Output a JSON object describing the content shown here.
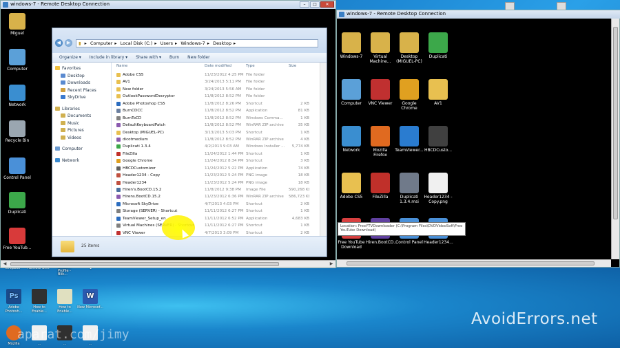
{
  "rdp_window_1": {
    "title": "windows-7 - Remote Desktop Connection"
  },
  "rdp_window_2": {
    "title": "windows-7 - Remote Desktop Connection"
  },
  "rdp1_desktop_icons": [
    {
      "label": "Miguel",
      "color": "#d8b24a"
    },
    {
      "label": "Computer",
      "color": "#5ba0d8"
    },
    {
      "label": "Network",
      "color": "#3a8ed0"
    },
    {
      "label": "Recycle Bin",
      "color": "#9aa6b0"
    },
    {
      "label": "Control Panel",
      "color": "#4a90d8"
    },
    {
      "label": "Duplicati",
      "color": "#3ca84a"
    },
    {
      "label": "Free YouTub...",
      "color": "#d83a3a"
    }
  ],
  "explorer": {
    "address": [
      "Computer",
      "Local Disk (C:)",
      "Users",
      "Windows-7",
      "Desktop"
    ],
    "toolbar": [
      "Organize ▾",
      "Include in library ▾",
      "Share with ▾",
      "Burn",
      "New folder"
    ],
    "nav": {
      "favorites_header": "Favorites",
      "favorites": [
        "Desktop",
        "Downloads",
        "Recent Places",
        "SkyDrive"
      ],
      "libraries_header": "Libraries",
      "libraries": [
        "Documents",
        "Music",
        "Pictures",
        "Videos"
      ],
      "computer": "Computer",
      "network": "Network"
    },
    "columns": {
      "name": "Name",
      "date": "Date modified",
      "type": "Type",
      "size": "Size"
    },
    "files": [
      {
        "name": "Adobe CS5",
        "date": "11/23/2012 4:25 PM",
        "type": "File folder",
        "size": "",
        "icon": "#e8c050"
      },
      {
        "name": "AV1",
        "date": "3/24/2013 5:11 PM",
        "type": "File folder",
        "size": "",
        "icon": "#e8c050"
      },
      {
        "name": "New folder",
        "date": "3/24/2013 5:56 AM",
        "type": "File folder",
        "size": "",
        "icon": "#e8c050"
      },
      {
        "name": "OutlookPasswordDecryptor",
        "date": "11/8/2012 8:52 PM",
        "type": "File folder",
        "size": "",
        "icon": "#e8c050"
      },
      {
        "name": "Adobe Photoshop CS5",
        "date": "11/8/2012 8:26 PM",
        "type": "Shortcut",
        "size": "2 KB",
        "icon": "#2a6cc0"
      },
      {
        "name": "BurnCDCC",
        "date": "11/8/2012 8:52 PM",
        "type": "Application",
        "size": "81 KB",
        "icon": "#6a7fa0"
      },
      {
        "name": "BurnToCD",
        "date": "11/8/2012 8:52 PM",
        "type": "Windows Comma...",
        "size": "1 KB",
        "icon": "#808080"
      },
      {
        "name": "DefaultKeyboardPatch",
        "date": "11/8/2012 8:52 PM",
        "type": "WinRAR ZIP archive",
        "size": "35 KB",
        "icon": "#8a5ab0"
      },
      {
        "name": "Desktop (MIGUEL-PC)",
        "date": "3/13/2013 5:03 PM",
        "type": "Shortcut",
        "size": "1 KB",
        "icon": "#e8c050"
      },
      {
        "name": "dicotmedium",
        "date": "11/8/2012 8:52 PM",
        "type": "WinRAR ZIP archive",
        "size": "4 KB",
        "icon": "#8a5ab0"
      },
      {
        "name": "Duplicati 1.3.4",
        "date": "4/2/2013 9:03 AM",
        "type": "Windows Installer ...",
        "size": "5,774 KB",
        "icon": "#3ca84a"
      },
      {
        "name": "FileZilla",
        "date": "11/24/2012 1:44 PM",
        "type": "Shortcut",
        "size": "1 KB",
        "icon": "#c0302a"
      },
      {
        "name": "Google Chrome",
        "date": "11/24/2012 8:34 PM",
        "type": "Shortcut",
        "size": "3 KB",
        "icon": "#e0a020"
      },
      {
        "name": "HBCDCustomizer",
        "date": "11/24/2012 5:22 PM",
        "type": "Application",
        "size": "74 KB",
        "icon": "#606060"
      },
      {
        "name": "Header1234 - Copy",
        "date": "11/23/2012 5:24 PM",
        "type": "PNG image",
        "size": "18 KB",
        "icon": "#c05040"
      },
      {
        "name": "Header1234",
        "date": "11/23/2012 5:24 PM",
        "type": "PNG image",
        "size": "18 KB",
        "icon": "#c05040"
      },
      {
        "name": "Hiren's.BootCD.15.2",
        "date": "11/8/2012 9:38 PM",
        "type": "Image File",
        "size": "590,268 KB",
        "icon": "#4a70a0"
      },
      {
        "name": "Hirens.BootCD.15.2",
        "date": "11/23/2012 6:36 PM",
        "type": "WinRAR ZIP archive",
        "size": "586,723 KB",
        "icon": "#8a5ab0"
      },
      {
        "name": "Microsoft SkyDrive",
        "date": "4/7/2013 4:03 PM",
        "type": "Shortcut",
        "size": "2 KB",
        "icon": "#2a6cc0"
      },
      {
        "name": "Storage (SERVER) - Shortcut",
        "date": "11/11/2012 6:27 PM",
        "type": "Shortcut",
        "size": "1 KB",
        "icon": "#808080"
      },
      {
        "name": "TeamViewer_Setup_en",
        "date": "11/11/2012 6:52 PM",
        "type": "Application",
        "size": "4,683 KB",
        "icon": "#2a6cc0"
      },
      {
        "name": "Virtual Machines (SERVER) - Shortcut",
        "date": "11/11/2012 6:27 PM",
        "type": "Shortcut",
        "size": "1 KB",
        "icon": "#808080"
      },
      {
        "name": "VNC Viewer",
        "date": "4/7/2013 3:09 PM",
        "type": "Shortcut",
        "size": "2 KB",
        "icon": "#c03030"
      }
    ],
    "status_count": "25 items"
  },
  "rdp2_desktop_icons": [
    {
      "label": "Windows-7",
      "color": "#d8b24a"
    },
    {
      "label": "Virtual Machine...",
      "color": "#d8b24a"
    },
    {
      "label": "Desktop (MIGUEL-PC)",
      "color": "#d8b24a"
    },
    {
      "label": "Duplicati",
      "color": "#3ca84a"
    },
    {
      "label": "Computer",
      "color": "#5ba0d8"
    },
    {
      "label": "VNC Viewer",
      "color": "#c03030"
    },
    {
      "label": "Google Chrome",
      "color": "#e0a020"
    },
    {
      "label": "AV1",
      "color": "#e8c050"
    },
    {
      "label": "Network",
      "color": "#3a8ed0"
    },
    {
      "label": "Mozilla Firefox",
      "color": "#e06a20"
    },
    {
      "label": "TeamViewer...",
      "color": "#2a7cd0"
    },
    {
      "label": "HBCDCusto...",
      "color": "#404040"
    },
    {
      "label": "Adobe CS5",
      "color": "#e8c050"
    },
    {
      "label": "FileZilla",
      "color": "#c0302a"
    },
    {
      "label": "Duplicati 1.3.4.msi",
      "color": "#707a8a"
    },
    {
      "label": "Header1234 - Copy.png",
      "color": "#f0f0f0"
    },
    {
      "label": "Free YouTube Download",
      "color": "#d84040"
    },
    {
      "label": "Hiren.BootCD...",
      "color": "#6040a0"
    },
    {
      "label": "Control Panel",
      "color": "#4a90d8"
    },
    {
      "label": "Header1234...",
      "color": "#4a90d8"
    }
  ],
  "tooltip": "Location: FreeYTVDownloader (C:\\Program Files\\DVDVideoSoft\\Free YouTube Download)",
  "local_desktop": {
    "top_labels": [
      "Dropbox",
      "Remote win7",
      "Outlook Profile - Blik...",
      "1"
    ],
    "icons": [
      {
        "label": "Adobe Photosh...",
        "color": "#1a4a8a"
      },
      {
        "label": "How to Enable...",
        "color": "#303030"
      },
      {
        "label": "How to Enable...",
        "color": "#e0e0c0"
      },
      {
        "label": "New Microsof...",
        "color": "#2a5ab0"
      },
      {
        "label": "Mozilla",
        "color": "#e06a20"
      },
      {
        "label": "...",
        "color": "#f0f0f0"
      },
      {
        "label": "...",
        "color": "#303030"
      },
      {
        "label": "...",
        "color": "#f0f0f0"
      }
    ]
  },
  "watermark": "AvoidErrors.net",
  "watermark2": "aparat.com/jimy"
}
